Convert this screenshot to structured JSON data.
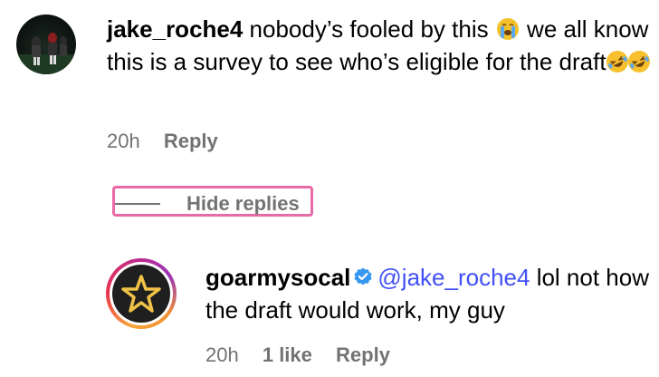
{
  "comment": {
    "username": "jake_roche4",
    "text_part1": " nobody’s fooled by this ",
    "text_part2": " we all know this is a survey to see who’s eligible for the draft",
    "time": "20h",
    "reply_label": "Reply",
    "emoji_after_part1": "loudly-crying-face",
    "emoji_end": [
      "rolling-on-floor-laughing",
      "rolling-on-floor-laughing"
    ]
  },
  "replies_toggle": {
    "label": "Hide replies",
    "highlight_color": "#e86aa6"
  },
  "reply": {
    "username": "goarmysocal",
    "verified": true,
    "mention": "@jake_roche4",
    "text": " lol not how the draft would work, my guy",
    "time": "20h",
    "likes": "1 like",
    "reply_label": "Reply",
    "avatar_icon": "gold-star-icon"
  },
  "colors": {
    "meta_gray": "#737373",
    "mention_blue": "#4150f7",
    "verified_blue": "#3797f0",
    "star_gold": "#f0c247"
  }
}
